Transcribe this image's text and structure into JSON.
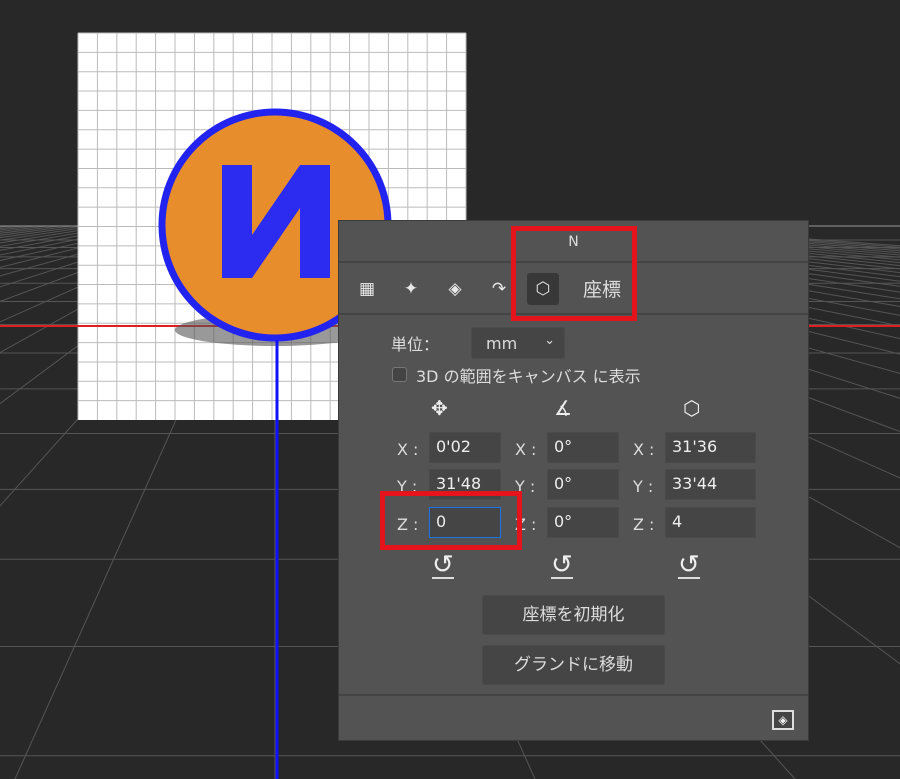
{
  "scene": {
    "canvas_letter": "N"
  },
  "panel": {
    "header_title": "N",
    "tabs": [
      {
        "icon": "mesh-icon"
      },
      {
        "icon": "deform-icon"
      },
      {
        "icon": "cap-icon"
      },
      {
        "icon": "inflate-icon"
      },
      {
        "icon": "coordinates-icon",
        "label": "座標",
        "active": true
      }
    ],
    "unit_label": "単位：",
    "unit_value": "mm",
    "show_extent_label": "3D の範囲をキャンバス に表示",
    "show_extent_checked": false,
    "columns": [
      {
        "icon": "move-icon",
        "fields": [
          {
            "axis": "X :",
            "value": "0'02"
          },
          {
            "axis": "Y :",
            "value": "31'48"
          },
          {
            "axis": "Z :",
            "value": "0"
          }
        ]
      },
      {
        "icon": "angle-icon",
        "fields": [
          {
            "axis": "X :",
            "value": "0°"
          },
          {
            "axis": "Y :",
            "value": "0°"
          },
          {
            "axis": "Z :",
            "value": "0°"
          }
        ]
      },
      {
        "icon": "scale-icon",
        "fields": [
          {
            "axis": "X :",
            "value": "31'36"
          },
          {
            "axis": "Y :",
            "value": "33'44"
          },
          {
            "axis": "Z :",
            "value": "4"
          }
        ]
      }
    ],
    "reset_button": "座標を初期化",
    "ground_button": "グランドに移動"
  },
  "colors": {
    "highlight": "#e5131b",
    "focus": "#1a73e8",
    "panel": "#535353"
  }
}
